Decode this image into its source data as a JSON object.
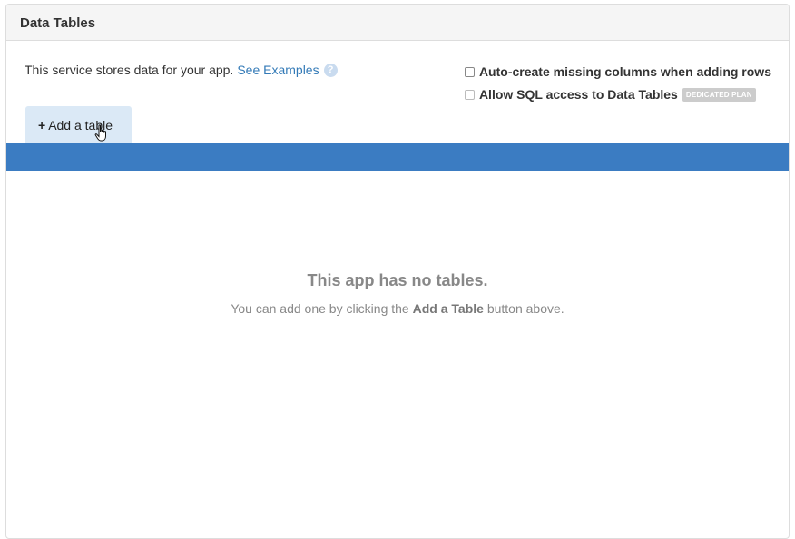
{
  "panel": {
    "title": "Data Tables"
  },
  "intro": {
    "text": "This service stores data for your app.",
    "link": "See Examples",
    "help_icon": "question-circle-icon",
    "help_glyph": "?"
  },
  "options": {
    "auto_create_label": "Auto-create missing columns when adding rows",
    "sql_access_label": "Allow SQL access to Data Tables",
    "sql_badge": "DEDICATED PLAN"
  },
  "add_button": {
    "icon": "plus-icon",
    "plus": "+",
    "label": "Add a table"
  },
  "empty_state": {
    "title": "This app has no tables.",
    "sub_prefix": "You can add one by clicking the",
    "sub_bold": "Add a Table",
    "sub_suffix": "button above."
  },
  "colors": {
    "accent_blue": "#3b7cc2",
    "link_blue": "#337ab7",
    "button_bg": "#dbe9f6"
  }
}
